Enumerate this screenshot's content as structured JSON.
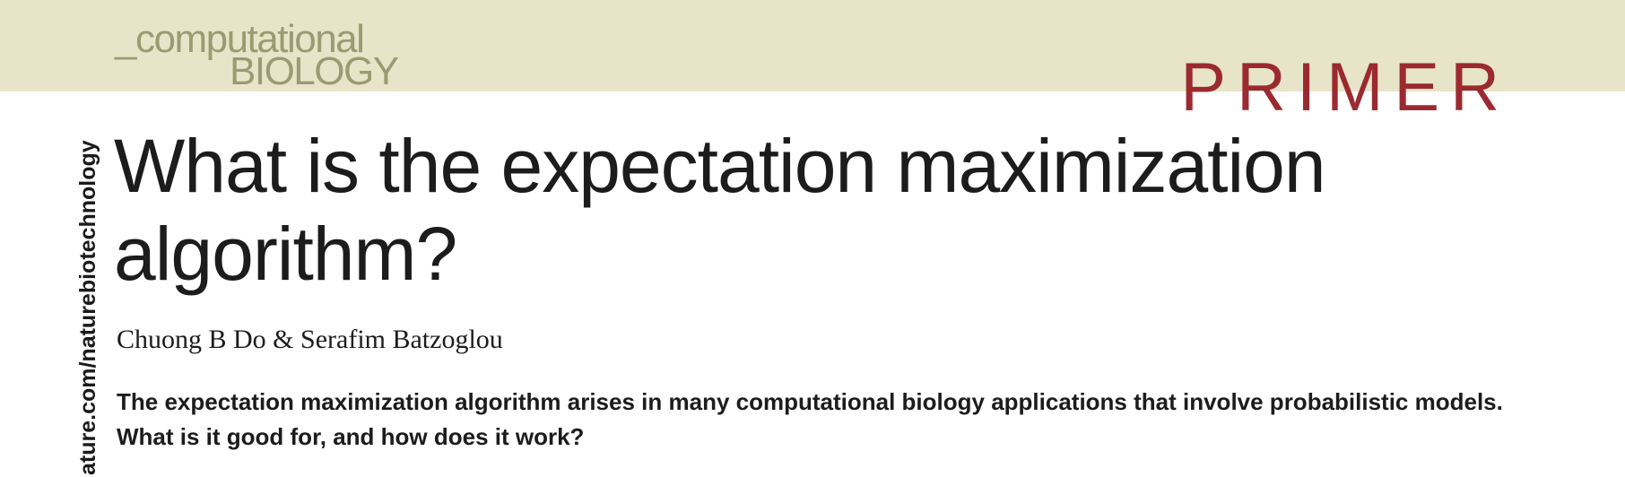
{
  "header": {
    "logo_line1": "_computational",
    "logo_line2": "BIOLOGY",
    "section_label": "PRIMER"
  },
  "sidebar": {
    "url": "ature.com/naturebiotechnology"
  },
  "article": {
    "title": "What is the expectation maximization algorithm?",
    "authors": "Chuong B Do & Serafim Batzoglou",
    "abstract": "The expectation maximization algorithm arises in many computational biology applications that involve probabilistic models. What is it good for, and how does it work?"
  },
  "colors": {
    "header_band": "#e8e4c9",
    "logo_text": "#9d9a72",
    "section_label": "#9b2a30",
    "body_text": "#1c1c1c"
  }
}
